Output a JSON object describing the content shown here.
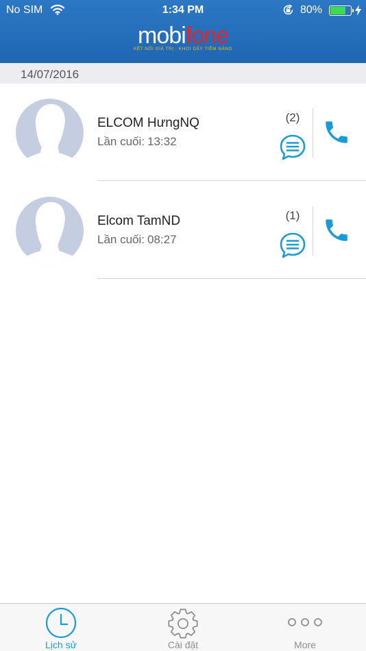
{
  "status_bar": {
    "carrier": "No SIM",
    "time": "1:34 PM",
    "battery_percent": "80%",
    "battery_level": 0.8
  },
  "header": {
    "logo_mobi": "mobi",
    "logo_fone": "fone",
    "logo_tagline": "KẾT NỐI GIÁ TRỊ  ·  KHƠI DẬY TIỀM NĂNG"
  },
  "date_section": "14/07/2016",
  "contacts": [
    {
      "name": "ELCOM HưngNQ",
      "last_label": "Lần cuối:",
      "last_time": "13:32",
      "count": "(2)"
    },
    {
      "name": "Elcom TamND",
      "last_label": "Lần cuối:",
      "last_time": "08:27",
      "count": "(1)"
    }
  ],
  "tabs": [
    {
      "label": "Lịch sử",
      "icon": "clock-icon",
      "active": true
    },
    {
      "label": "Cài đặt",
      "icon": "gear-icon",
      "active": false
    },
    {
      "label": "More",
      "icon": "more-dots-icon",
      "active": false
    }
  ],
  "colors": {
    "header": "#2170bb",
    "accent": "#1a9ad6",
    "logo_red": "#e8232a",
    "tagline": "#f3c21b",
    "avatar": "#c5cee0"
  }
}
